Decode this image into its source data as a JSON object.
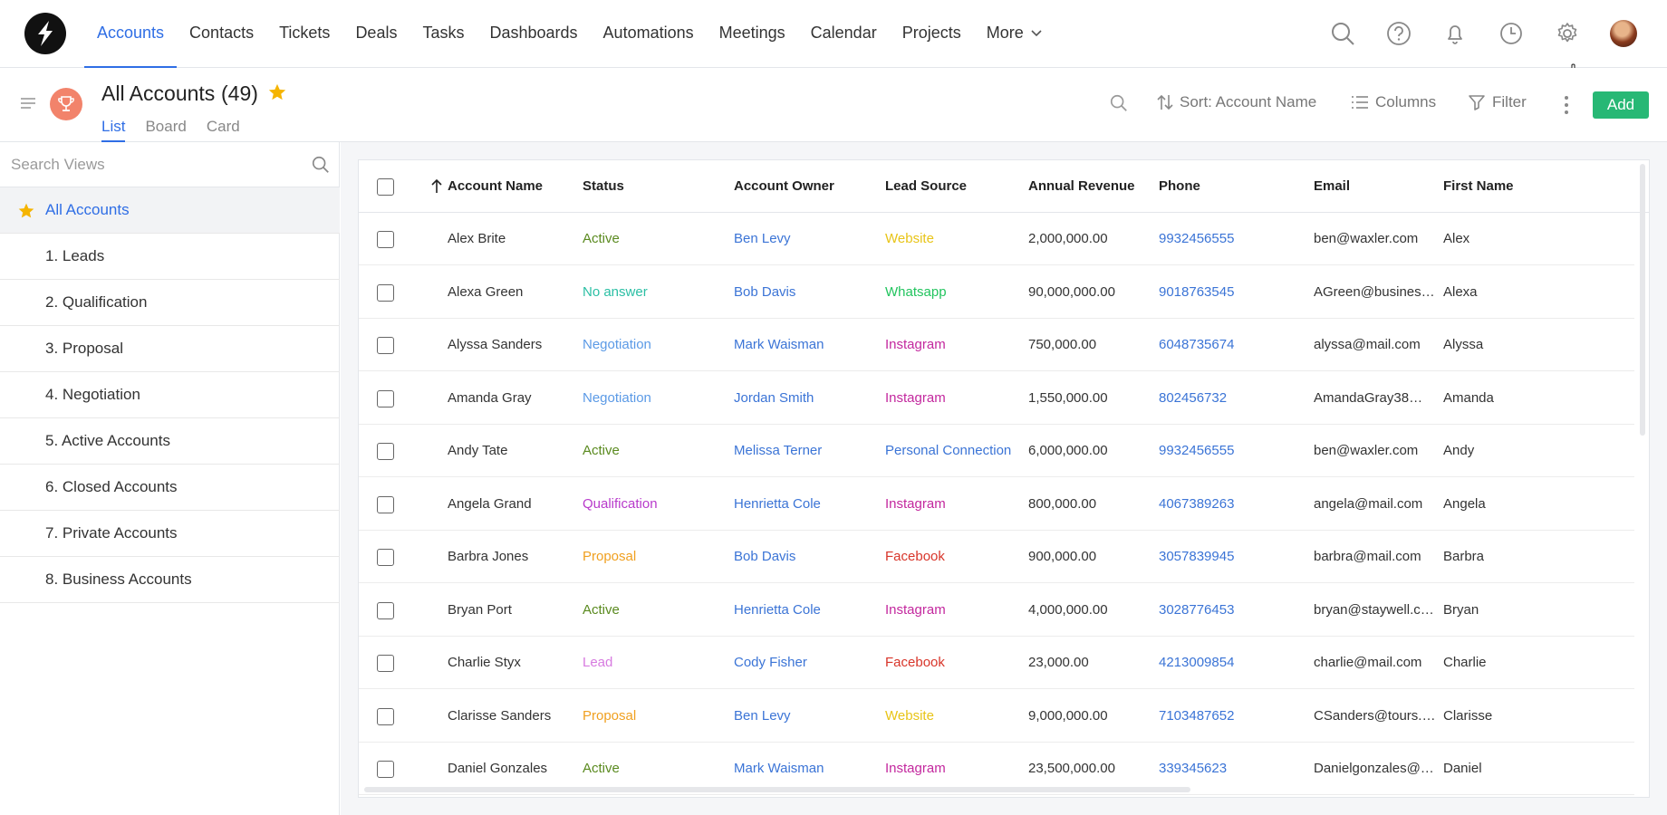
{
  "nav": {
    "items": [
      {
        "label": "Accounts",
        "active": true
      },
      {
        "label": "Contacts"
      },
      {
        "label": "Tickets"
      },
      {
        "label": "Deals"
      },
      {
        "label": "Tasks"
      },
      {
        "label": "Dashboards"
      },
      {
        "label": "Automations"
      },
      {
        "label": "Meetings"
      },
      {
        "label": "Calendar"
      },
      {
        "label": "Projects"
      }
    ],
    "more_label": "More",
    "icons": [
      "search-icon",
      "help-icon",
      "bell-icon",
      "clock-icon",
      "gear-icon",
      "user-avatar"
    ]
  },
  "header": {
    "title": "All Accounts",
    "count": "(49)",
    "views": [
      "List",
      "Board",
      "Card"
    ],
    "active_view": "List",
    "sort_label": "Sort: Account Name",
    "columns_label": "Columns",
    "filter_label": "Filter",
    "add_label": "Add"
  },
  "sidebar": {
    "search_placeholder": "Search Views",
    "items": [
      {
        "label": "All Accounts",
        "active": true
      },
      {
        "label": "1. Leads"
      },
      {
        "label": "2. Qualification"
      },
      {
        "label": "3. Proposal"
      },
      {
        "label": "4. Negotiation"
      },
      {
        "label": "5. Active Accounts"
      },
      {
        "label": "6. Closed Accounts"
      },
      {
        "label": "7. Private Accounts"
      },
      {
        "label": "8. Business Accounts"
      }
    ]
  },
  "table": {
    "columns": [
      "Account Name",
      "Status",
      "Account Owner",
      "Lead Source",
      "Annual Revenue",
      "Phone",
      "Email",
      "First Name"
    ],
    "rows": [
      {
        "name": "Alex Brite",
        "status": "Active",
        "owner": "Ben Levy",
        "source": "Website",
        "revenue": "2,000,000.00",
        "phone": "9932456555",
        "email": "ben@waxler.com",
        "first": "Alex"
      },
      {
        "name": "Alexa Green",
        "status": "No answer",
        "owner": "Bob Davis",
        "source": "Whatsapp",
        "revenue": "90,000,000.00",
        "phone": "9018763545",
        "email": "AGreen@busines…",
        "first": "Alexa"
      },
      {
        "name": "Alyssa Sanders",
        "status": "Negotiation",
        "owner": "Mark Waisman",
        "source": "Instagram",
        "revenue": "750,000.00",
        "phone": "6048735674",
        "email": "alyssa@mail.com",
        "first": "Alyssa"
      },
      {
        "name": "Amanda Gray",
        "status": "Negotiation",
        "owner": "Jordan Smith",
        "source": "Instagram",
        "revenue": "1,550,000.00",
        "phone": "802456732",
        "email": "AmandaGray38@…",
        "first": "Amanda"
      },
      {
        "name": "Andy Tate",
        "status": "Active",
        "owner": "Melissa Terner",
        "source": "Personal Connection",
        "revenue": "6,000,000.00",
        "phone": "9932456555",
        "email": "ben@waxler.com",
        "first": "Andy"
      },
      {
        "name": "Angela Grand",
        "status": "Qualification",
        "owner": "Henrietta Cole",
        "source": "Instagram",
        "revenue": "800,000.00",
        "phone": "4067389263",
        "email": "angela@mail.com",
        "first": "Angela"
      },
      {
        "name": "Barbra Jones",
        "status": "Proposal",
        "owner": "Bob Davis",
        "source": "Facebook",
        "revenue": "900,000.00",
        "phone": "3057839945",
        "email": "barbra@mail.com",
        "first": "Barbra"
      },
      {
        "name": "Bryan Port",
        "status": "Active",
        "owner": "Henrietta Cole",
        "source": "Instagram",
        "revenue": "4,000,000.00",
        "phone": "3028776453",
        "email": "bryan@staywell.c…",
        "first": "Bryan"
      },
      {
        "name": "Charlie Styx",
        "status": "Lead",
        "owner": "Cody Fisher",
        "source": "Facebook",
        "revenue": "23,000.00",
        "phone": "4213009854",
        "email": "charlie@mail.com",
        "first": "Charlie"
      },
      {
        "name": "Clarisse Sanders",
        "status": "Proposal",
        "owner": "Ben Levy",
        "source": "Website",
        "revenue": "9,000,000.00",
        "phone": "7103487652",
        "email": "CSanders@tours.…",
        "first": "Clarisse"
      },
      {
        "name": "Daniel Gonzales",
        "status": "Active",
        "owner": "Mark Waisman",
        "source": "Instagram",
        "revenue": "23,500,000.00",
        "phone": "339345623",
        "email": "Danielgonzales@…",
        "first": "Daniel"
      }
    ]
  },
  "colors": {
    "accent": "#2f6ee5",
    "add_button": "#27b875",
    "star": "#f5b400",
    "status": {
      "Active": "#5a8a1f",
      "No answer": "#2bbfa4",
      "Negotiation": "#5b9ae6",
      "Qualification": "#b83acb",
      "Proposal": "#f0a020",
      "Lead": "#d77be0"
    },
    "source": {
      "Website": "#e8c417",
      "Whatsapp": "#22c45e",
      "Instagram": "#c3289e",
      "Personal Connection": "#3b74d6",
      "Facebook": "#d8352a"
    }
  }
}
